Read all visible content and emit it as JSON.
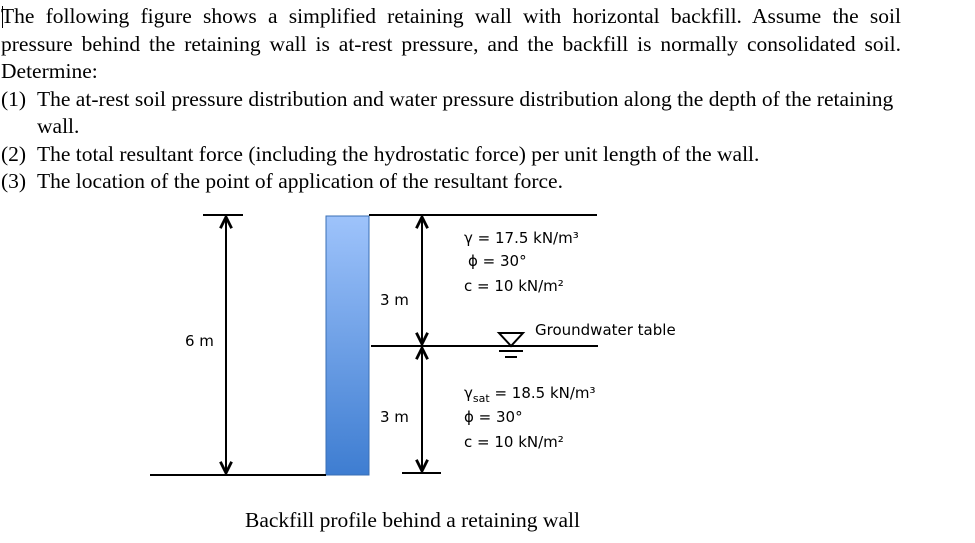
{
  "problem": {
    "intro": "The following figure shows a simplified retaining wall with horizontal backfill. Assume the soil pressure behind the retaining wall is at-rest pressure, and the backfill is normally consolidated soil. Determine:",
    "items": [
      {
        "num": "(1)",
        "text": "The at-rest soil pressure distribution and water pressure distribution along the depth of the retaining wall."
      },
      {
        "num": "(2)",
        "text": "The total resultant force (including the hydrostatic force) per unit length of the wall."
      },
      {
        "num": "(3)",
        "text": "The location of the point of application of the resultant force."
      }
    ]
  },
  "figure": {
    "total_height_label": "6 m",
    "upper_layer_label": "3 m",
    "lower_layer_label": "3 m",
    "groundwater_label": "Groundwater table",
    "upper_layer": {
      "gamma": "γ = 17.5 kN/m³",
      "phi": "ϕ = 30°",
      "c": "c = 10 kN/m²"
    },
    "lower_layer": {
      "gamma_symbol": "γ",
      "gamma_sub": "sat",
      "gamma_value": " = 18.5 kN/m³",
      "phi": "ϕ = 30°",
      "c": "c = 10 kN/m²"
    },
    "wall_color_top": "#9ec3fb",
    "wall_color_bottom": "#3e7dd1"
  },
  "caption": "Backfill profile behind a retaining wall"
}
